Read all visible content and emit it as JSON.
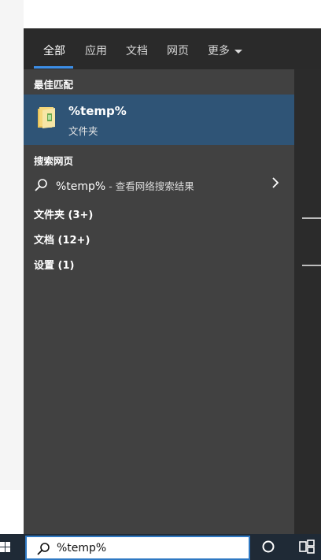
{
  "tabs": [
    {
      "label": "全部",
      "active": true
    },
    {
      "label": "应用",
      "active": false
    },
    {
      "label": "文档",
      "active": false
    },
    {
      "label": "网页",
      "active": false
    },
    {
      "label": "更多",
      "active": false
    }
  ],
  "sections": {
    "best_match": "最佳匹配",
    "search_web": "搜索网页"
  },
  "best_match_item": {
    "title": "%temp%",
    "subtitle": "文件夹",
    "icon": "folder-icon"
  },
  "web_result": {
    "query": "%temp%",
    "suffix": " - 查看网络搜索结果"
  },
  "categories": [
    {
      "label": "文件夹 (3+)"
    },
    {
      "label": "文档 (12+)"
    },
    {
      "label": "设置 (1)"
    }
  ],
  "taskbar": {
    "search_value": "%temp%"
  },
  "colors": {
    "panel": "#414141",
    "highlight": "#2f5476",
    "accent": "#3c8ee6",
    "taskbar": "#1f2a36"
  }
}
